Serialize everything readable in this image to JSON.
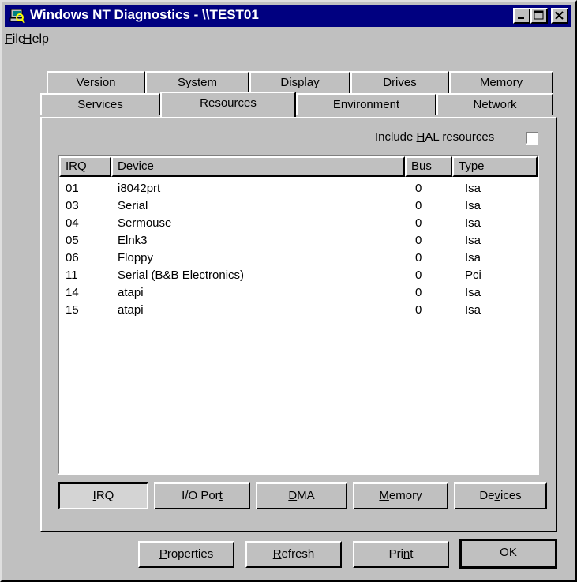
{
  "window": {
    "title": "Windows NT Diagnostics - \\\\TEST01",
    "icon": "diagnostics-computer-icon"
  },
  "menu": [
    {
      "pre": "",
      "key": "F",
      "post": "ile"
    },
    {
      "pre": "",
      "key": "H",
      "post": "elp"
    }
  ],
  "tabs_back": [
    "Version",
    "System",
    "Display",
    "Drives",
    "Memory"
  ],
  "tabs_front": [
    "Services",
    "Resources",
    "Environment",
    "Network"
  ],
  "active_tab": "Resources",
  "hal": {
    "pre": "Include ",
    "key": "H",
    "post": "AL resources",
    "checked": false
  },
  "list": {
    "columns": [
      "IRQ",
      "Device",
      "Bus",
      "Type"
    ],
    "type_col_key": {
      "pre": "T",
      "key": "y",
      "post": "pe"
    },
    "rows": [
      {
        "irq": "01",
        "device": "i8042prt",
        "bus": "0",
        "type": "Isa"
      },
      {
        "irq": "03",
        "device": "Serial",
        "bus": "0",
        "type": "Isa"
      },
      {
        "irq": "04",
        "device": "Sermouse",
        "bus": "0",
        "type": "Isa"
      },
      {
        "irq": "05",
        "device": "Elnk3",
        "bus": "0",
        "type": "Isa"
      },
      {
        "irq": "06",
        "device": "Floppy",
        "bus": "0",
        "type": "Isa"
      },
      {
        "irq": "11",
        "device": "Serial (B&B Electronics)",
        "bus": "0",
        "type": "Pci"
      },
      {
        "irq": "14",
        "device": "atapi",
        "bus": "0",
        "type": "Isa"
      },
      {
        "irq": "15",
        "device": "atapi",
        "bus": "0",
        "type": "Isa"
      }
    ]
  },
  "resource_buttons": [
    {
      "pre": "",
      "key": "I",
      "post": "RQ",
      "pressed": true
    },
    {
      "pre": "I/O Por",
      "key": "t",
      "post": "",
      "pressed": false
    },
    {
      "pre": "",
      "key": "D",
      "post": "MA",
      "pressed": false
    },
    {
      "pre": "",
      "key": "M",
      "post": "emory",
      "pressed": false
    },
    {
      "pre": "De",
      "key": "v",
      "post": "ices",
      "pressed": false
    }
  ],
  "dialog_buttons": [
    {
      "pre": "",
      "key": "P",
      "post": "roperties"
    },
    {
      "pre": "",
      "key": "R",
      "post": "efresh"
    },
    {
      "pre": "Pri",
      "key": "n",
      "post": "t"
    },
    {
      "pre": "OK",
      "key": "",
      "post": ""
    }
  ]
}
